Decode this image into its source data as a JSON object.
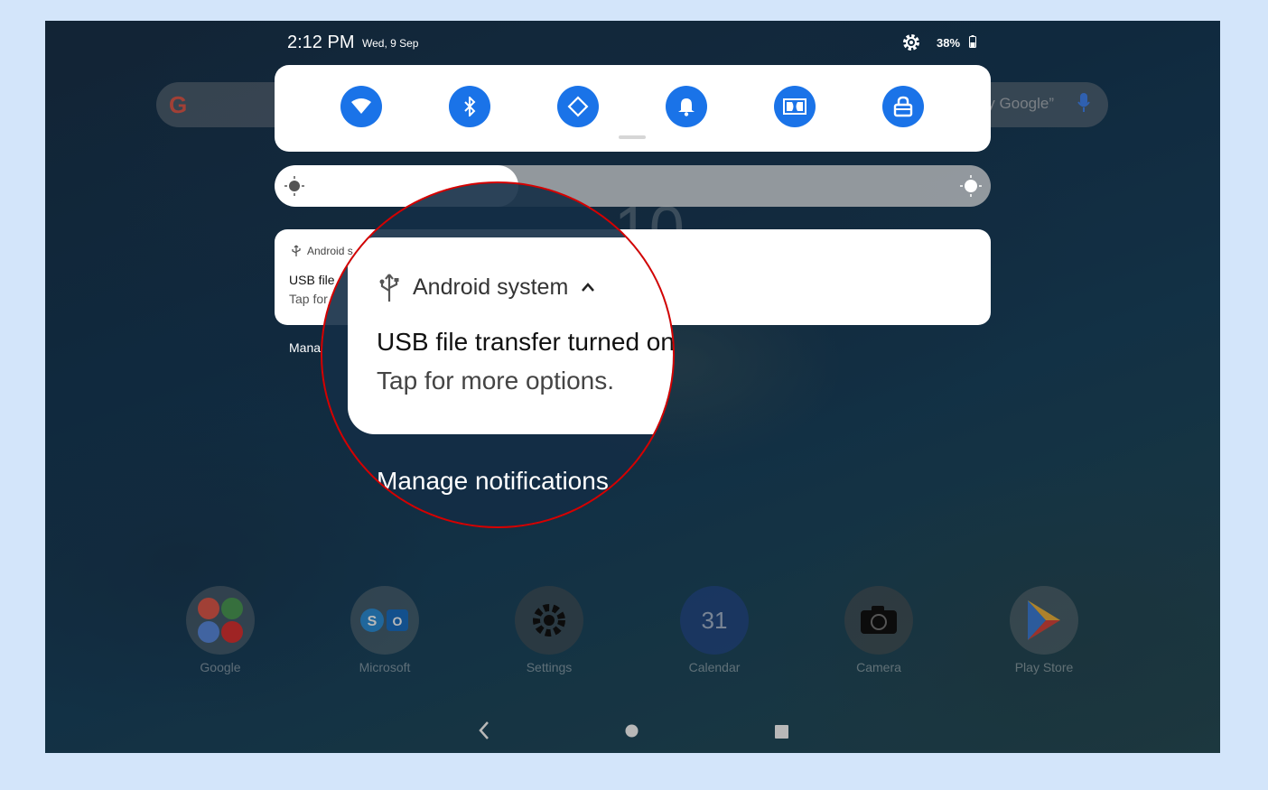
{
  "status_bar": {
    "time": "2:12 PM",
    "date": "Wed, 9 Sep",
    "battery": "38%"
  },
  "home_search": {
    "logo": "G",
    "hint": "y Google”"
  },
  "quick_settings": {
    "tiles": [
      {
        "name": "wifi-icon"
      },
      {
        "name": "bluetooth-icon"
      },
      {
        "name": "auto-rotate-icon"
      },
      {
        "name": "notifications-bell-icon"
      },
      {
        "name": "dolby-icon"
      },
      {
        "name": "lock-icon"
      }
    ],
    "accent": "#1a73e8"
  },
  "brightness": {
    "level": 0.34
  },
  "background_clock": "10",
  "notification": {
    "app_name_truncated": "Android s",
    "title_truncated": "USB file",
    "text_truncated": "Tap for",
    "manage_truncated": "Mana"
  },
  "magnified": {
    "app_name": "Android system",
    "title": "USB file transfer turned on",
    "text": "Tap for more options.",
    "manage": "Manage notifications",
    "ring_color": "#d50000"
  },
  "dock": [
    {
      "label": "Google"
    },
    {
      "label": "Microsoft"
    },
    {
      "label": "Settings"
    },
    {
      "label": "Calendar",
      "badge": "31"
    },
    {
      "label": "Camera"
    },
    {
      "label": "Play Store"
    }
  ]
}
